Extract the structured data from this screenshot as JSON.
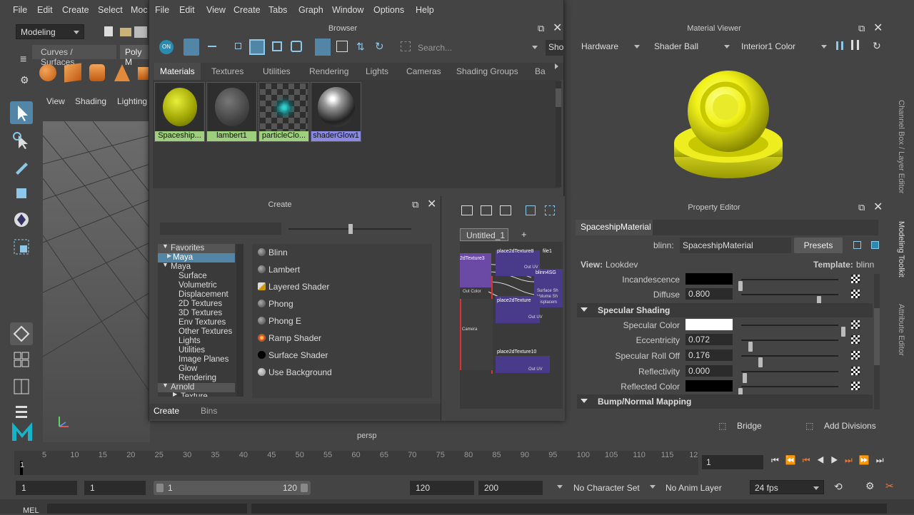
{
  "maya_menu": {
    "file": "File",
    "edit": "Edit",
    "create": "Create",
    "select": "Select",
    "mod": "Moc"
  },
  "mode_dropdown": "Modeling",
  "shelf_tabs": {
    "curves": "Curves / Surfaces",
    "poly": "Poly M"
  },
  "viewport_menu": {
    "view": "View",
    "shading": "Shading",
    "lighting": "Lighting"
  },
  "viewport_label": "persp",
  "hypershade_menu": [
    "File",
    "Edit",
    "View",
    "Create",
    "Tabs",
    "Graph",
    "Window",
    "Options",
    "Help"
  ],
  "browser": {
    "title": "Browser",
    "search_placeholder": "Search...",
    "show_label": "Sho",
    "tabs": [
      "Materials",
      "Textures",
      "Utilities",
      "Rendering",
      "Lights",
      "Cameras",
      "Shading Groups",
      "Ba"
    ],
    "swatches": [
      "Spaceship...",
      "lambert1",
      "particleClo...",
      "shaderGlow1"
    ]
  },
  "create_panel": {
    "title": "Create",
    "tree": [
      "Favorites",
      "Maya",
      "Maya",
      "Surface",
      "Volumetric",
      "Displacement",
      "2D Textures",
      "3D Textures",
      "Env Textures",
      "Other Textures",
      "Lights",
      "Utilities",
      "Image Planes",
      "Glow",
      "Rendering",
      "Arnold",
      "Texture"
    ],
    "items": [
      "Blinn",
      "Lambert",
      "Layered Shader",
      "Phong",
      "Phong E",
      "Ramp Shader",
      "Surface Shader",
      "Use Background"
    ],
    "bottom_tabs": [
      "Create",
      "Bins"
    ]
  },
  "graph": {
    "tab": "Untitled_1",
    "add": "+",
    "nodes": [
      "2dTexture3",
      "place2dTexture8",
      "file1",
      "blinn4SG",
      "place2dTexture",
      "place2dTexture10"
    ],
    "labels": [
      "Out UV",
      "Out Color",
      "Surface Sh",
      "Volume Sh",
      "Displacem",
      "Camera",
      "Out UV",
      "Out UV"
    ]
  },
  "material_viewer": {
    "title": "Material Viewer",
    "renderer": "Hardware",
    "shape": "Shader Ball",
    "env": "Interior1 Color"
  },
  "property_editor": {
    "title": "Property Editor",
    "tab": "SpaceshipMaterial",
    "type_label": "blinn:",
    "name": "SpaceshipMaterial",
    "presets": "Presets",
    "view_label": "View:",
    "view_value": "Lookdev",
    "template_label": "Template:",
    "template_value": "blinn",
    "rows_top": [
      {
        "label": "Incandescence",
        "value": "",
        "color": "#000000",
        "knob": 0.0
      },
      {
        "label": "Diffuse",
        "value": "0.800",
        "color": "",
        "knob": 0.8
      }
    ],
    "section1": "Specular Shading",
    "rows_spec": [
      {
        "label": "Specular Color",
        "value": "",
        "color": "#ffffff",
        "knob": 1.0
      },
      {
        "label": "Eccentricity",
        "value": "0.072",
        "color": "",
        "knob": 0.072
      },
      {
        "label": "Specular Roll Off",
        "value": "0.176",
        "color": "",
        "knob": 0.176
      },
      {
        "label": "Reflectivity",
        "value": "0.000",
        "color": "",
        "knob": 0.0
      },
      {
        "label": "Reflected Color",
        "value": "",
        "color": "#000000",
        "knob": 0.0
      }
    ],
    "section2": "Bump/Normal Mapping"
  },
  "right_sidebar": [
    "Channel Box / Layer Editor",
    "Modeling Toolkit",
    "Attribute Editor"
  ],
  "toolkit": {
    "bridge": "Bridge",
    "add_divisions": "Add Divisions"
  },
  "timeline": {
    "ticks": [
      "5",
      "10",
      "15",
      "20",
      "25",
      "30",
      "35",
      "40",
      "45",
      "50",
      "55",
      "60",
      "65",
      "70",
      "75",
      "80",
      "85",
      "90",
      "95",
      "100",
      "105",
      "110",
      "115",
      "12"
    ],
    "start": "1",
    "current": "1"
  },
  "range": {
    "start1": "1",
    "start2": "1",
    "slider_start": "1",
    "slider_end": "120",
    "end1": "120",
    "end2": "200",
    "char_set": "No Character Set",
    "anim_layer": "No Anim Layer",
    "fps": "24 fps"
  },
  "cmd": "MEL"
}
